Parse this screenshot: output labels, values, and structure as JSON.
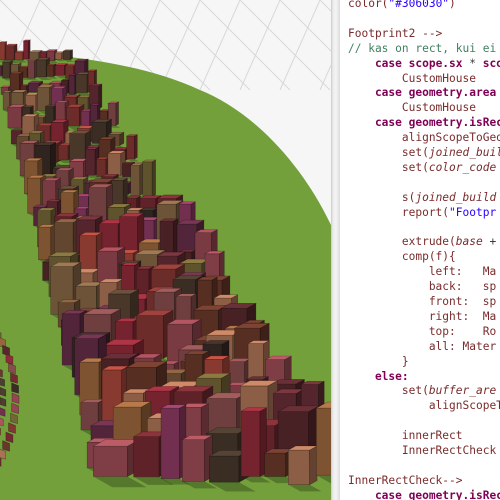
{
  "editor": {
    "lines": [
      [
        {
          "t": "color(",
          "c": "t-rule"
        },
        {
          "t": "\"#306030\"",
          "c": "t-str"
        },
        {
          "t": ")",
          "c": "t-rule"
        }
      ],
      [],
      [
        {
          "t": "Footprint2 -->",
          "c": "t-rule"
        }
      ],
      [
        {
          "t": "// kas on rect, kui ei",
          "c": "t-cmt"
        }
      ],
      [
        {
          "t": "    case ",
          "c": "t-kw"
        },
        {
          "t": "scope.sx ",
          "c": "t-kw"
        },
        {
          "t": "* ",
          "c": "t-plain"
        },
        {
          "t": "sco",
          "c": "t-kw"
        }
      ],
      [
        {
          "t": "        CustomHouse",
          "c": "t-rule"
        }
      ],
      [
        {
          "t": "    case ",
          "c": "t-kw"
        },
        {
          "t": "geometry.area",
          "c": "t-kw"
        }
      ],
      [
        {
          "t": "        CustomHouse",
          "c": "t-rule"
        }
      ],
      [
        {
          "t": "    case ",
          "c": "t-kw"
        },
        {
          "t": "geometry.isRec",
          "c": "t-kw"
        }
      ],
      [
        {
          "t": "        alignScopeToGeo",
          "c": "t-rule"
        }
      ],
      [
        {
          "t": "        set(",
          "c": "t-rule"
        },
        {
          "t": "joined_buil",
          "c": "t-ital"
        }
      ],
      [
        {
          "t": "        set(",
          "c": "t-rule"
        },
        {
          "t": "color_code",
          "c": "t-ital"
        }
      ],
      [],
      [
        {
          "t": "        s(",
          "c": "t-rule"
        },
        {
          "t": "joined_build",
          "c": "t-ital"
        }
      ],
      [
        {
          "t": "        report(",
          "c": "t-rule"
        },
        {
          "t": "\"Footpr",
          "c": "t-str"
        }
      ],
      [],
      [
        {
          "t": "        extrude(",
          "c": "t-rule"
        },
        {
          "t": "base",
          "c": "t-ital"
        },
        {
          "t": " +",
          "c": "t-plain"
        }
      ],
      [
        {
          "t": "        comp(f){",
          "c": "t-rule"
        }
      ],
      [
        {
          "t": "            left:   Ma",
          "c": "t-rule"
        }
      ],
      [
        {
          "t": "            back:   sp",
          "c": "t-rule"
        }
      ],
      [
        {
          "t": "            front:  sp",
          "c": "t-rule"
        }
      ],
      [
        {
          "t": "            right:  Ma",
          "c": "t-rule"
        }
      ],
      [
        {
          "t": "            top:    Ro",
          "c": "t-rule"
        }
      ],
      [
        {
          "t": "            all: Mater",
          "c": "t-rule"
        }
      ],
      [
        {
          "t": "        }",
          "c": "t-rule"
        }
      ],
      [
        {
          "t": "    else:",
          "c": "t-kw"
        }
      ],
      [
        {
          "t": "        set(",
          "c": "t-rule"
        },
        {
          "t": "buffer_are",
          "c": "t-ital"
        }
      ],
      [
        {
          "t": "            alignScopeT",
          "c": "t-rule"
        }
      ],
      [],
      [
        {
          "t": "        innerRect",
          "c": "t-rule"
        }
      ],
      [
        {
          "t": "        InnerRectCheck",
          "c": "t-rule"
        }
      ],
      [],
      [
        {
          "t": "InnerRectCheck-->",
          "c": "t-rule"
        }
      ],
      [
        {
          "t": "    case ",
          "c": "t-kw"
        },
        {
          "t": "geometry.isRec",
          "c": "t-kw"
        }
      ]
    ]
  },
  "colors": {
    "grass": "#74a03c",
    "ground_plane": "#f6f6f6",
    "grid_line": "#d8d8d8",
    "building_palette": [
      "#7a2c34",
      "#8a3a36",
      "#5c2a30",
      "#9c4a55",
      "#6e3b2c",
      "#a3505a",
      "#4a3a2e",
      "#7e5a3c",
      "#8c6a48",
      "#6a2f4a",
      "#943c66",
      "#b04a3e",
      "#5e4636",
      "#a06a40",
      "#6c3038",
      "#7a6a3a",
      "#3e2e2a",
      "#8e5050",
      "#b4785a",
      "#962e3c"
    ]
  },
  "icons": [
    "splitter-handle"
  ]
}
